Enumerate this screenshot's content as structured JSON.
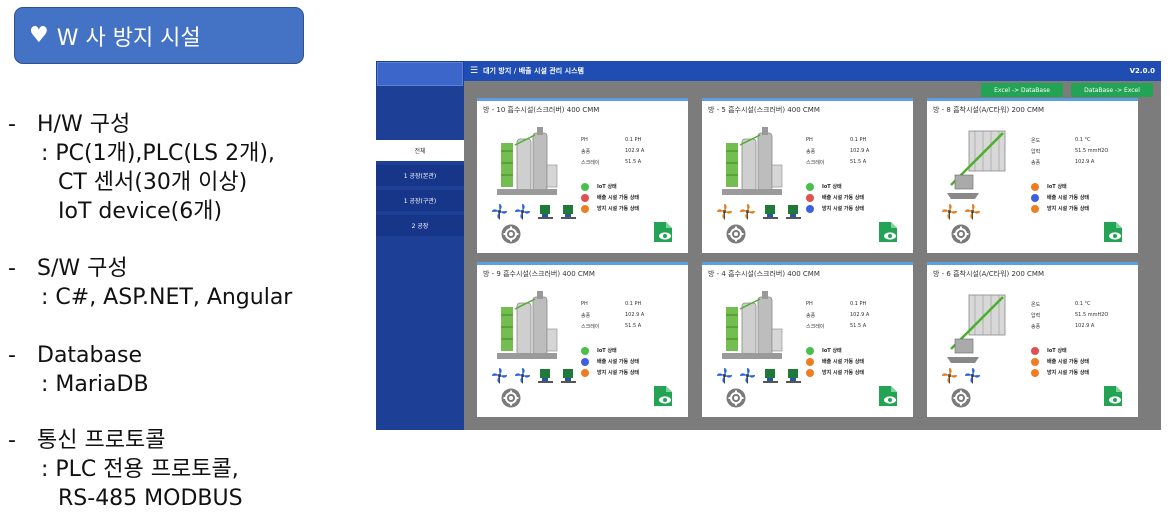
{
  "slide": {
    "title": "W 사 방지 시설",
    "bullets": [
      {
        "dash": "-",
        "head": "H/W 구성",
        "lines": [
          ": PC(1개),PLC(LS 2개),",
          "CT 센서(30개 이상)",
          "IoT device(6개)"
        ]
      },
      {
        "dash": "-",
        "head": "S/W 구성",
        "lines": [
          ": C#, ASP.NET, Angular"
        ]
      },
      {
        "dash": "-",
        "head": "Database",
        "lines": [
          ": MariaDB"
        ]
      },
      {
        "dash": "-",
        "head": "통신 프로토콜",
        "lines": [
          ": PLC 전용 프로토콜,",
          "RS-485 MODBUS"
        ]
      }
    ]
  },
  "app": {
    "title": "대기 방지 / 배출 시설 관리 시스템",
    "version": "V2.0.0",
    "menu_icon": "menu-icon",
    "sidebar": [
      "전체",
      "1 공장(본관)",
      "1 공장(구관)",
      "2 공장"
    ],
    "buttons": {
      "excel_to_db": "Excel -> DataBase",
      "db_to_excel": "DataBase -> Excel"
    },
    "colors": {
      "header": "#1f4db3",
      "sidebar": "#1d3f95",
      "button": "#23a455",
      "status_green": "#48c04a",
      "status_orange": "#ef7d22",
      "status_blue": "#3d5fe0",
      "status_red": "#e05050"
    },
    "cards": [
      {
        "title": "방 - 10 흡수시설(스크러버) 400 CMM",
        "metrics": [
          [
            "PH",
            "0.1 PH"
          ],
          [
            "송풍",
            "102.9 A"
          ],
          [
            "스크레이",
            "51.5 A"
          ]
        ],
        "statuses": [
          "IoT 상태",
          "배출 시설 가동 상태",
          "방지 시설 가동 상태"
        ],
        "status_colors": [
          "green",
          "red",
          "orange"
        ],
        "fans": [
          "blue",
          "blue",
          "pump",
          "pump"
        ]
      },
      {
        "title": "방 - 5 흡수시설(스크러버) 400 CMM",
        "metrics": [
          [
            "PH",
            "0.1 PH"
          ],
          [
            "송풍",
            "102.9 A"
          ],
          [
            "스크레이",
            "51.5 A"
          ]
        ],
        "statuses": [
          "IoT 상태",
          "배출 시설 가동 상태",
          "방지 시설 가동 상태"
        ],
        "status_colors": [
          "green",
          "red",
          "blue"
        ],
        "fans": [
          "orange",
          "orange",
          "pump",
          "pump"
        ]
      },
      {
        "title": "방 - 8 흡착시설(A/C타워) 200 CMM",
        "metrics": [
          [
            "온도",
            "0.1 °C"
          ],
          [
            "압력",
            "51.5 mmH2O"
          ],
          [
            "송풍",
            "102.9 A"
          ]
        ],
        "statuses": [
          "IoT 상태",
          "배출 시설 가동 상태",
          "방지 시설 가동 상태"
        ],
        "status_colors": [
          "orange",
          "blue",
          "orange"
        ],
        "fans": [
          "orange",
          "orange"
        ]
      },
      {
        "title": "방 - 9 흡수시설(스크러버) 400 CMM",
        "metrics": [
          [
            "PH",
            "0.1 PH"
          ],
          [
            "송풍",
            "102.9 A"
          ],
          [
            "스크레이",
            "51.5 A"
          ]
        ],
        "statuses": [
          "IoT 상태",
          "배출 시설 가동 상태",
          "방지 시설 가동 상태"
        ],
        "status_colors": [
          "green",
          "blue",
          "orange"
        ],
        "fans": [
          "blue",
          "blue",
          "pump",
          "pump"
        ]
      },
      {
        "title": "방 - 4 흡수시설(스크러버) 400 CMM",
        "metrics": [
          [
            "PH",
            "0.1 PH"
          ],
          [
            "송풍",
            "102.9 A"
          ],
          [
            "스크레이",
            "51.5 A"
          ]
        ],
        "statuses": [
          "IoT 상태",
          "배출 시설 가동 상태",
          "방지 시설 가동 상태"
        ],
        "status_colors": [
          "green",
          "orange",
          "orange"
        ],
        "fans": [
          "blue",
          "blue",
          "pump",
          "pump"
        ]
      },
      {
        "title": "방 - 6 흡착시설(A/C타워) 200 CMM",
        "metrics": [
          [
            "온도",
            "0.1 °C"
          ],
          [
            "압력",
            "51.5 mmH2O"
          ],
          [
            "송풍",
            "102.9 A"
          ]
        ],
        "statuses": [
          "IoT 상태",
          "배출 시설 가동 상태",
          "방지 시설 가동 상태"
        ],
        "status_colors": [
          "red",
          "orange",
          "orange"
        ],
        "fans": [
          "orange",
          "blue"
        ]
      }
    ]
  }
}
